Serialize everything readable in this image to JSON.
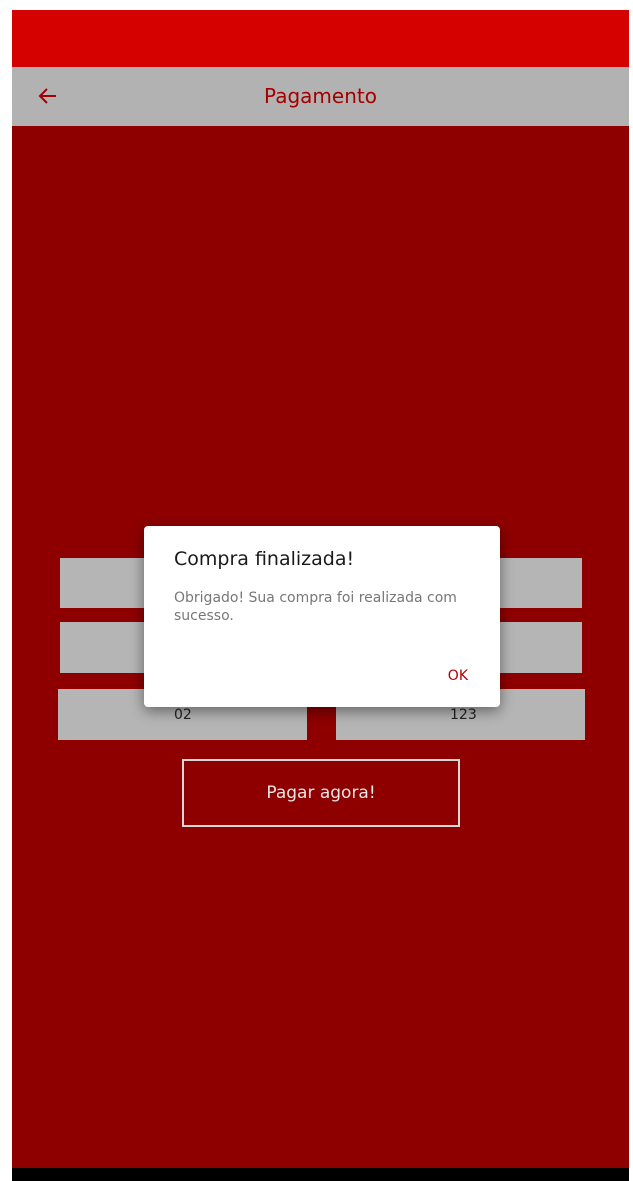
{
  "app_bar": {
    "title": "Pagamento",
    "back_icon": "arrow-left-icon"
  },
  "form": {
    "expiry_value": "02",
    "cvv_value": "123",
    "pay_button_label": "Pagar agora!"
  },
  "dialog": {
    "title": "Compra finalizada!",
    "message": "Obrigado! Sua compra foi realizada com sucesso.",
    "ok_label": "OK"
  },
  "colors": {
    "status_bar": "#d50000",
    "app_bar": "#b2b2b2",
    "background": "#8e0000",
    "accent": "#a40000"
  }
}
